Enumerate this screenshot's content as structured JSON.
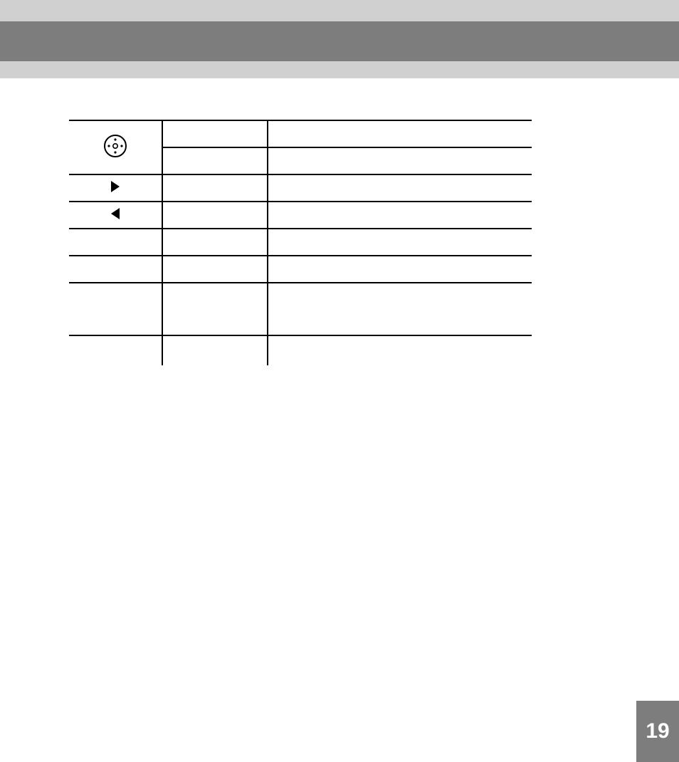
{
  "page_number": "19",
  "table": {
    "rows": [
      {
        "icon": "movie-reel",
        "c2": "",
        "c3": ""
      },
      {
        "icon": "",
        "c2": "",
        "c3": ""
      },
      {
        "icon": "play-right",
        "c2": "",
        "c3": ""
      },
      {
        "icon": "play-left",
        "c2": "",
        "c3": ""
      },
      {
        "icon": "",
        "c2": "",
        "c3": ""
      },
      {
        "icon": "",
        "c2": "",
        "c3": ""
      },
      {
        "icon": "",
        "c2": "",
        "c3": ""
      }
    ]
  }
}
